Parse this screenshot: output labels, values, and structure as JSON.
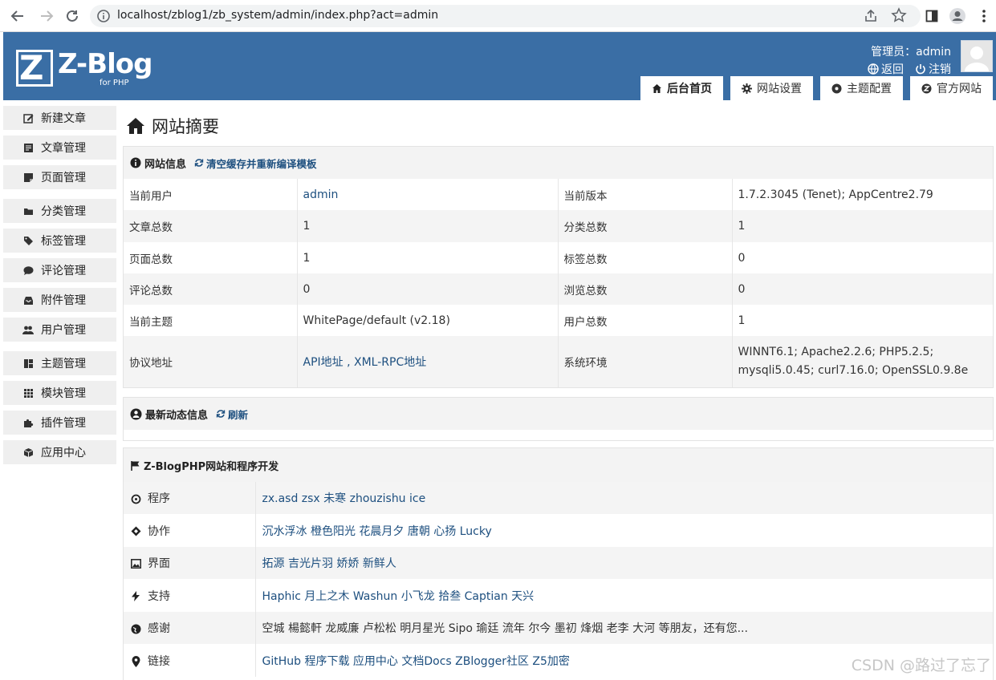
{
  "browser": {
    "url": "localhost/zblog1/zb_system/admin/index.php?act=admin"
  },
  "header": {
    "logo_text": "Z-Blog",
    "logo_sub": "for PHP",
    "user_label": "管理员：admin",
    "back_label": "返回",
    "logout_label": "注销",
    "colors": {
      "header_bg": "#3a6ea5",
      "link": "#1d4f7f"
    },
    "tabs": [
      {
        "label": "后台首页",
        "icon": "home-icon"
      },
      {
        "label": "网站设置",
        "icon": "gear-icon"
      },
      {
        "label": "主题配置",
        "icon": "theme-icon"
      },
      {
        "label": "官方网站",
        "icon": "zblog-icon"
      }
    ]
  },
  "sidebar": {
    "items": [
      {
        "label": "新建文章",
        "icon": "edit-icon"
      },
      {
        "label": "文章管理",
        "icon": "article-icon"
      },
      {
        "label": "页面管理",
        "icon": "page-icon"
      },
      {
        "label": "分类管理",
        "icon": "folder-icon"
      },
      {
        "label": "标签管理",
        "icon": "tag-icon"
      },
      {
        "label": "评论管理",
        "icon": "comment-icon"
      },
      {
        "label": "附件管理",
        "icon": "inbox-icon"
      },
      {
        "label": "用户管理",
        "icon": "users-icon"
      },
      {
        "label": "主题管理",
        "icon": "layout-icon"
      },
      {
        "label": "模块管理",
        "icon": "grid-icon"
      },
      {
        "label": "插件管理",
        "icon": "puzzle-icon"
      },
      {
        "label": "应用中心",
        "icon": "box-icon"
      }
    ]
  },
  "main": {
    "title": "网站摘要",
    "site_info": {
      "heading": "网站信息",
      "action": "清空缓存并重新编译模板",
      "rows": [
        [
          "当前用户",
          "admin",
          "当前版本",
          "1.7.2.3045 (Tenet); AppCentre2.79"
        ],
        [
          "文章总数",
          "1",
          "分类总数",
          "1"
        ],
        [
          "页面总数",
          "1",
          "标签总数",
          "0"
        ],
        [
          "评论总数",
          "0",
          "浏览总数",
          "0"
        ],
        [
          "当前主题",
          "WhitePage/default (v2.18)",
          "用户总数",
          "1"
        ]
      ],
      "protocol_label": "协议地址",
      "protocol_value": "API地址 , XML-RPC地址",
      "env_label": "系统环境",
      "env_line1": "WINNT6.1; Apache2.2.6; PHP5.2.5;",
      "env_line2": "mysqli5.0.45; curl7.16.0; OpenSSL0.9.8e"
    },
    "news": {
      "heading": "最新动态信息",
      "action": "刷新"
    },
    "dev": {
      "heading": "Z-BlogPHP网站和程序开发",
      "rows": [
        {
          "label": "程序",
          "icon": "gear-icon",
          "value": "zx.asd zsx 未寒 zhouzishu ice"
        },
        {
          "label": "协作",
          "icon": "diamonds-icon",
          "value": "沉水浮冰 橙色阳光 花晨月夕 唐朝 心扬 Lucky"
        },
        {
          "label": "界面",
          "icon": "image-icon",
          "value": "拓源 吉光片羽 娇娇 新鲜人"
        },
        {
          "label": "支持",
          "icon": "bolt-icon",
          "value": "Haphic 月上之木 Washun 小飞龙 拾叁 Captian 天兴"
        },
        {
          "label": "感谢",
          "icon": "globe-icon",
          "value": "空城 楊懿軒 龙威廉 卢松松 明月星光 Sipo 瑜廷 流年 尔今 墨初 烽烟 老李 大河",
          "suffix": "等朋友，还有您..."
        },
        {
          "label": "链接",
          "icon": "pin-icon",
          "value": "GitHub 程序下载  应用中心  文档Docs  ZBlogger社区  Z5加密"
        }
      ]
    }
  },
  "watermark": "CSDN @路过了忘了"
}
